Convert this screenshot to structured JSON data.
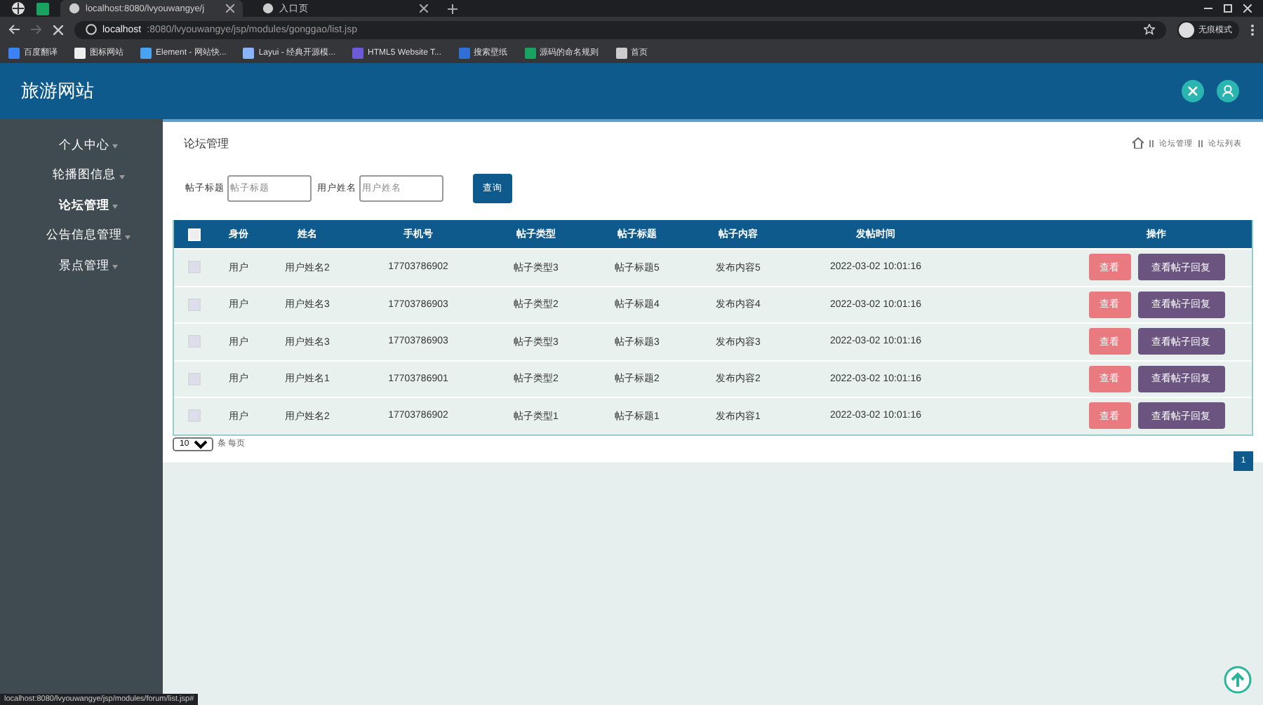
{
  "browser": {
    "tabs": [
      {
        "title": "localhost:8080/lvyouwangye/j",
        "selected": true
      },
      {
        "title": "入口页",
        "selected": false
      }
    ],
    "url_host": "localhost",
    "url_rest": ":8080/lvyouwangye/jsp/modules/gonggao/list.jsp",
    "profile": "无痕模式",
    "bookmarks": [
      "百度翻译",
      "图标网站",
      "Element - 网站快...",
      "Layui - 经典开源模...",
      "HTML5 Website T...",
      "搜索壁纸",
      "源码的命名规则",
      "首页"
    ],
    "status_url": "localhost:8080/lvyouwangye/jsp/modules/forum/list.jsp#"
  },
  "app": {
    "title": "旅游网站"
  },
  "sidebar": {
    "items": [
      {
        "label": "个人中心",
        "selected": false
      },
      {
        "label": "轮播图信息",
        "selected": false
      },
      {
        "label": "论坛管理",
        "selected": true
      },
      {
        "label": "公告信息管理",
        "selected": false
      },
      {
        "label": "景点管理",
        "selected": false
      }
    ]
  },
  "page": {
    "title": "论坛管理",
    "breadcrumb": [
      "论坛管理",
      "论坛列表"
    ]
  },
  "search": {
    "fields": [
      {
        "label": "帖子标题",
        "placeholder": "帖子标题"
      },
      {
        "label": "用户姓名",
        "placeholder": "用户姓名"
      }
    ],
    "button": "查询"
  },
  "table": {
    "select_all_checked": false,
    "columns": [
      "身份",
      "姓名",
      "手机号",
      "帖子类型",
      "帖子标题",
      "帖子内容",
      "发帖时间",
      "操作"
    ],
    "rows": [
      {
        "checked": false,
        "cells": [
          "用户",
          "用户姓名2",
          "17703786902",
          "帖子类型3",
          "帖子标题5",
          "发布内容5",
          "2022-03-02 10:01:16"
        ],
        "actions": [
          "查看",
          "查看帖子回复"
        ]
      },
      {
        "checked": false,
        "cells": [
          "用户",
          "用户姓名3",
          "17703786903",
          "帖子类型2",
          "帖子标题4",
          "发布内容4",
          "2022-03-02 10:01:16"
        ],
        "actions": [
          "查看",
          "查看帖子回复"
        ]
      },
      {
        "checked": false,
        "cells": [
          "用户",
          "用户姓名3",
          "17703786903",
          "帖子类型3",
          "帖子标题3",
          "发布内容3",
          "2022-03-02 10:01:16"
        ],
        "actions": [
          "查看",
          "查看帖子回复"
        ]
      },
      {
        "checked": false,
        "cells": [
          "用户",
          "用户姓名1",
          "17703786901",
          "帖子类型2",
          "帖子标题2",
          "发布内容2",
          "2022-03-02 10:01:16"
        ],
        "actions": [
          "查看",
          "查看帖子回复"
        ]
      },
      {
        "checked": false,
        "cells": [
          "用户",
          "用户姓名2",
          "17703786902",
          "帖子类型1",
          "帖子标题1",
          "发布内容1",
          "2022-03-02 10:01:16"
        ],
        "actions": [
          "查看",
          "查看帖子回复"
        ]
      }
    ]
  },
  "pagination": {
    "page_size": "10",
    "page_size_label": "条 每页",
    "pages": [
      {
        "label": "1",
        "selected": true
      }
    ]
  }
}
